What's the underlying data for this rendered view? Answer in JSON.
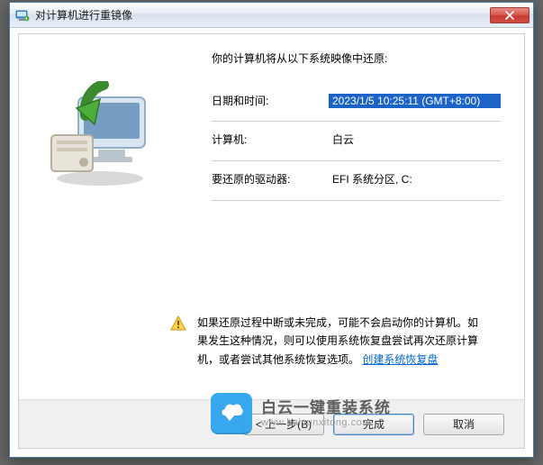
{
  "window": {
    "title": "对计算机进行重镜像",
    "close_label": "Close"
  },
  "main": {
    "heading": "你的计算机将从以下系统映像中还原:",
    "rows": {
      "datetime": {
        "label": "日期和时间:",
        "value": "2023/1/5 10:25:11 (GMT+8:00)"
      },
      "computer": {
        "label": "计算机:",
        "value": "白云"
      },
      "drives": {
        "label": "要还原的驱动器:",
        "value": "EFI 系统分区, C:"
      }
    },
    "warning": {
      "text_part1": "如果还原过程中断或未完成，可能不会启动你的计算机。如果发生这种情况，则可以使用系统恢复盘尝试再次还原计算机，或者尝试其他系统恢复选项。",
      "link_text": "创建系统恢复盘"
    }
  },
  "footer": {
    "back": "< 上一步(B)",
    "finish": "完成",
    "cancel": "取消"
  },
  "watermark": {
    "line1": "白云一键重装系统",
    "line2": "www.baiyunxitong.com"
  }
}
